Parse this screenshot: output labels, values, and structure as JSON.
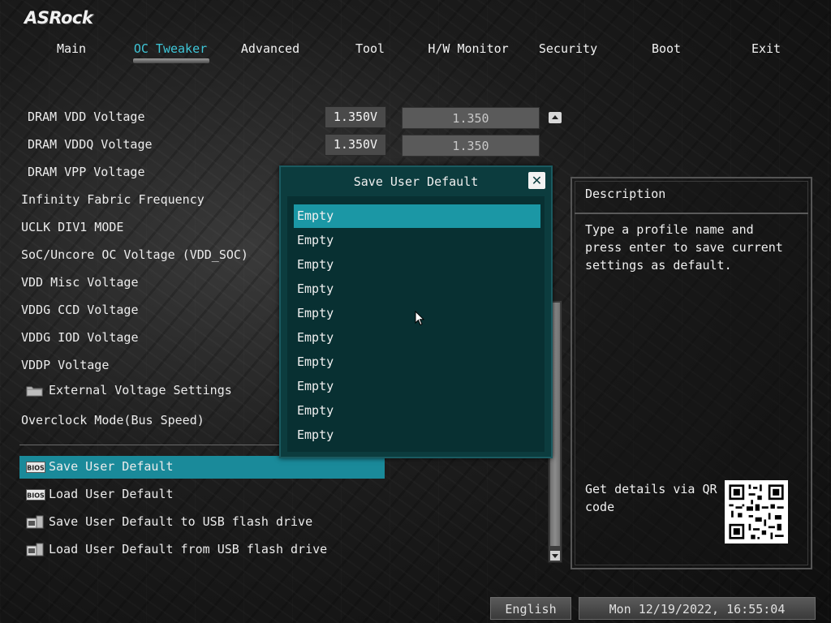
{
  "brand": "ASRock",
  "tabs": [
    "Main",
    "OC Tweaker",
    "Advanced",
    "Tool",
    "H/W Monitor",
    "Security",
    "Boot",
    "Exit"
  ],
  "active_tab": "OC Tweaker",
  "settings": [
    {
      "label": "DRAM VDD Voltage",
      "value": "1.350V",
      "field": "1.350"
    },
    {
      "label": "DRAM VDDQ Voltage",
      "value": "1.350V",
      "field": "1.350"
    },
    {
      "label": "DRAM VPP Voltage"
    },
    {
      "label": "Infinity Fabric Frequency"
    },
    {
      "label": "UCLK DIV1 MODE"
    },
    {
      "label": "SoC/Uncore OC Voltage (VDD_SOC)"
    },
    {
      "label": "VDD Misc Voltage"
    },
    {
      "label": "VDDG CCD Voltage"
    },
    {
      "label": "VDDG IOD Voltage"
    },
    {
      "label": "VDDP Voltage"
    },
    {
      "label": "External Voltage Settings"
    },
    {
      "label": "Overclock Mode(Bus Speed)"
    }
  ],
  "profile_actions": [
    {
      "label": "Save User Default",
      "icon": "bios-icon"
    },
    {
      "label": "Load User Default",
      "icon": "bios-icon"
    },
    {
      "label": "Save User Default to USB flash drive",
      "icon": "usb-drive-icon"
    },
    {
      "label": "Load User Default from USB flash drive",
      "icon": "usb-drive-icon"
    }
  ],
  "dialog": {
    "title": "Save User Default",
    "close_label": "✕",
    "items": [
      "Empty",
      "Empty",
      "Empty",
      "Empty",
      "Empty",
      "Empty",
      "Empty",
      "Empty",
      "Empty",
      "Empty"
    ]
  },
  "description": {
    "title": "Description",
    "text": "Type a profile name and press enter to save current settings as default.",
    "qr_text": "Get details via QR code"
  },
  "footer": {
    "language": "English",
    "datetime": "Mon 12/19/2022, 16:55:04"
  },
  "colors": {
    "accent": "#3ec6d8",
    "selection": "#1a8a9a",
    "dialog_bg": "#0c3c3e"
  }
}
